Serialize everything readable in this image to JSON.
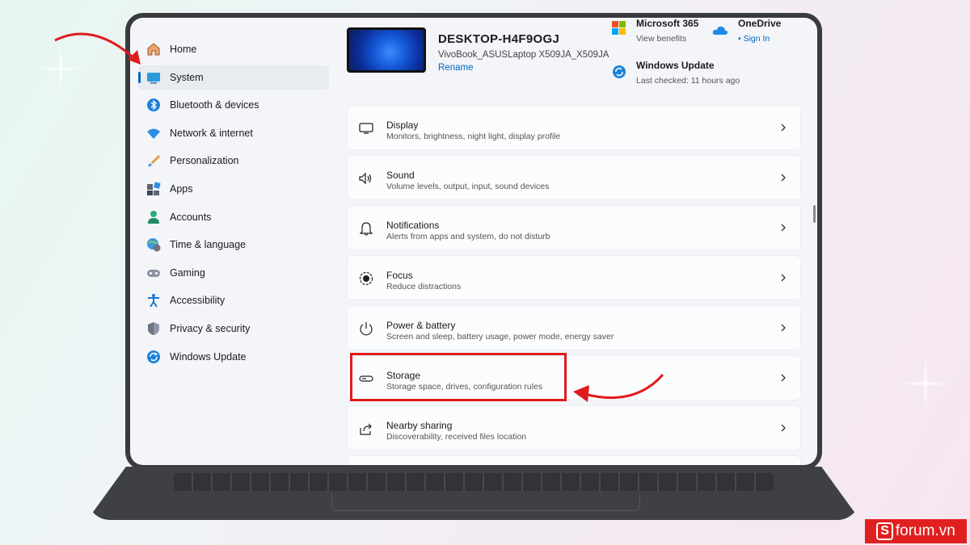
{
  "sidebar": {
    "items": [
      {
        "label": "Home",
        "icon": "home-icon"
      },
      {
        "label": "System",
        "icon": "system-icon",
        "selected": true
      },
      {
        "label": "Bluetooth & devices",
        "icon": "bluetooth-icon"
      },
      {
        "label": "Network & internet",
        "icon": "wifi-icon"
      },
      {
        "label": "Personalization",
        "icon": "brush-icon"
      },
      {
        "label": "Apps",
        "icon": "apps-icon"
      },
      {
        "label": "Accounts",
        "icon": "person-icon"
      },
      {
        "label": "Time & language",
        "icon": "globe-clock-icon"
      },
      {
        "label": "Gaming",
        "icon": "controller-icon"
      },
      {
        "label": "Accessibility",
        "icon": "accessibility-icon"
      },
      {
        "label": "Privacy & security",
        "icon": "shield-icon"
      },
      {
        "label": "Windows Update",
        "icon": "update-icon"
      }
    ]
  },
  "header": {
    "device_name": "DESKTOP-H4F9OGJ",
    "device_model": "VivoBook_ASUSLaptop X509JA_X509JA",
    "rename": "Rename",
    "microsoft365": {
      "title": "Microsoft 365",
      "subtitle": "View benefits"
    },
    "onedrive": {
      "title": "OneDrive",
      "subtitle": "• Sign In"
    },
    "windows_update": {
      "title": "Windows Update",
      "subtitle": "Last checked: 11 hours ago"
    }
  },
  "rows": [
    {
      "title": "Display",
      "subtitle": "Monitors, brightness, night light, display profile",
      "icon": "monitor-icon"
    },
    {
      "title": "Sound",
      "subtitle": "Volume levels, output, input, sound devices",
      "icon": "speaker-icon"
    },
    {
      "title": "Notifications",
      "subtitle": "Alerts from apps and system, do not disturb",
      "icon": "bell-icon"
    },
    {
      "title": "Focus",
      "subtitle": "Reduce distractions",
      "icon": "focus-icon"
    },
    {
      "title": "Power & battery",
      "subtitle": "Screen and sleep, battery usage, power mode, energy saver",
      "icon": "power-icon"
    },
    {
      "title": "Storage",
      "subtitle": "Storage space, drives, configuration rules",
      "icon": "storage-drive-icon"
    },
    {
      "title": "Nearby sharing",
      "subtitle": "Discoverability, received files location",
      "icon": "share-icon"
    }
  ],
  "colors": {
    "accent": "#0067c0",
    "highlight": "#e01b1b"
  },
  "brand": {
    "text": "forum.vn",
    "logo_letter": "S"
  }
}
